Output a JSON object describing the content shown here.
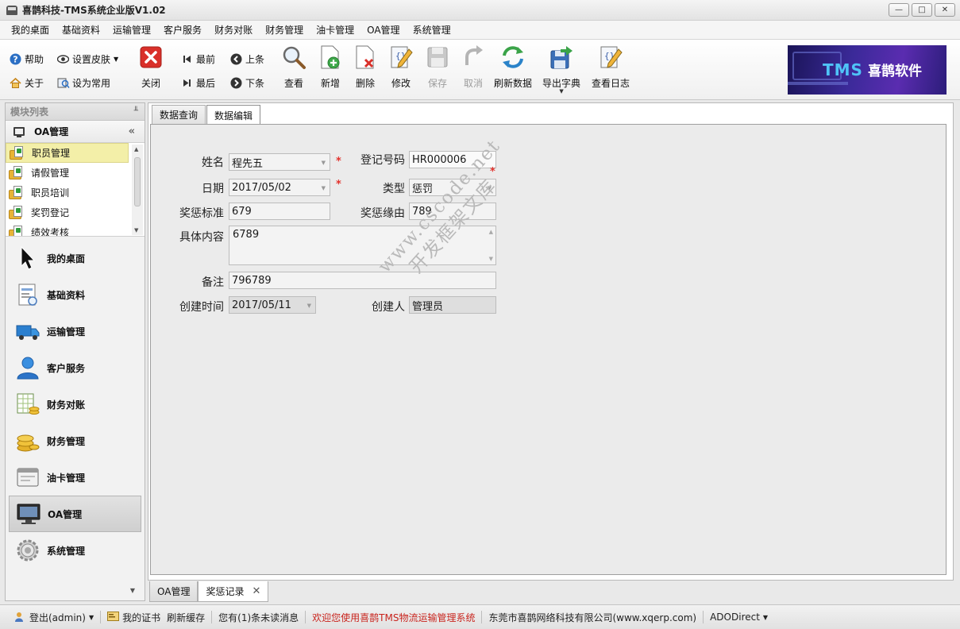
{
  "window": {
    "title": "喜鹊科技-TMS系统企业版V1.02",
    "minimize": "—",
    "maximize": "□",
    "close": "✕"
  },
  "menu": [
    "我的桌面",
    "基础资料",
    "运输管理",
    "客户服务",
    "财务对账",
    "财务管理",
    "油卡管理",
    "OA管理",
    "系统管理"
  ],
  "ribbon": {
    "help": "帮助",
    "skin": "设置皮肤",
    "about": "关于",
    "set_common": "设为常用",
    "close": "关闭",
    "first": "最前",
    "last": "最后",
    "prev": "上条",
    "next": "下条",
    "view": "查看",
    "add": "新增",
    "delete": "删除",
    "edit": "修改",
    "save": "保存",
    "cancel": "取消",
    "refresh": "刷新数据",
    "export_dict": "导出字典",
    "view_log": "查看日志"
  },
  "logo": {
    "tms": "TMS",
    "name": "喜鹊软件"
  },
  "left": {
    "header": "模块列表",
    "group": "OA管理",
    "sub_items": [
      "职员管理",
      "请假管理",
      "职员培训",
      "奖罚登记",
      "绩效考核"
    ],
    "nav": [
      "我的桌面",
      "基础资料",
      "运输管理",
      "客户服务",
      "财务对账",
      "财务管理",
      "油卡管理",
      "OA管理",
      "系统管理"
    ]
  },
  "tabs_top": [
    "数据查询",
    "数据编辑"
  ],
  "form": {
    "name_label": "姓名",
    "name_value": "程先五",
    "regno_label": "登记号码",
    "regno_value": "HR000006",
    "date_label": "日期",
    "date_value": "2017/05/02",
    "type_label": "类型",
    "type_value": "惩罚",
    "standard_label": "奖惩标准",
    "standard_value": "679",
    "reason_label": "奖惩缘由",
    "reason_value": "789",
    "content_label": "具体内容",
    "content_value": "6789",
    "remark_label": "备注",
    "remark_value": "796789",
    "created_label": "创建时间",
    "created_value": "2017/05/11",
    "creator_label": "创建人",
    "creator_value": "管理员",
    "required_mark": "*"
  },
  "watermark": {
    "line1": "www.cscode.net",
    "line2": "开发框架文库"
  },
  "tabs_bottom": [
    "OA管理",
    "奖惩记录"
  ],
  "status": {
    "logout": "登出(admin)",
    "cert": "我的证书",
    "refresh_cache": "刷新缓存",
    "unread": "您有(1)条未读消息",
    "welcome": "欢迎您使用喜鹊TMS物流运输管理系统",
    "company": "东莞市喜鹊网络科技有限公司(www.xqerp.com)",
    "db": "ADODirect"
  },
  "colors": {
    "required": "#e3322c",
    "active_item": "#f3efa8",
    "welcome_text": "#c9251e",
    "logo_bg": "#3b2a99",
    "logo_tms": "#4fc3f7"
  }
}
